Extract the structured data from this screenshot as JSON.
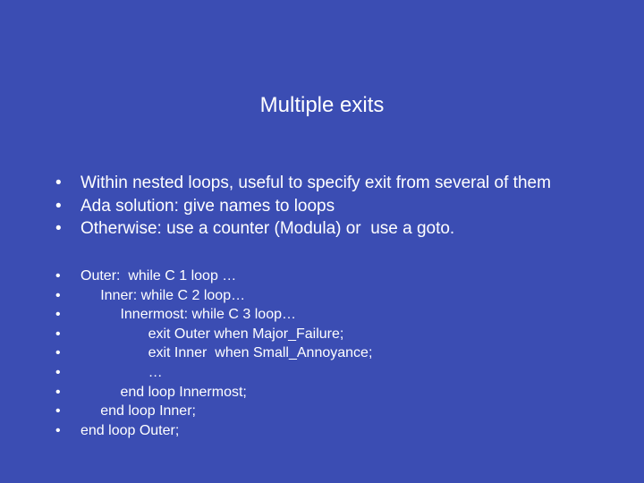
{
  "title": "Multiple exits",
  "main_bullets": [
    "Within nested loops, useful to specify exit from several of them",
    "Ada solution: give names to loops",
    "Otherwise: use a counter (Modula) or  use a goto."
  ],
  "code_bullets": [
    "Outer:  while C 1 loop …",
    "     Inner: while C 2 loop…",
    "          Innermost: while C 3 loop…",
    "                 exit Outer when Major_Failure;",
    "                 exit Inner  when Small_Annoyance;",
    "                 …",
    "          end loop Innermost;",
    "     end loop Inner;",
    "end loop Outer;"
  ]
}
